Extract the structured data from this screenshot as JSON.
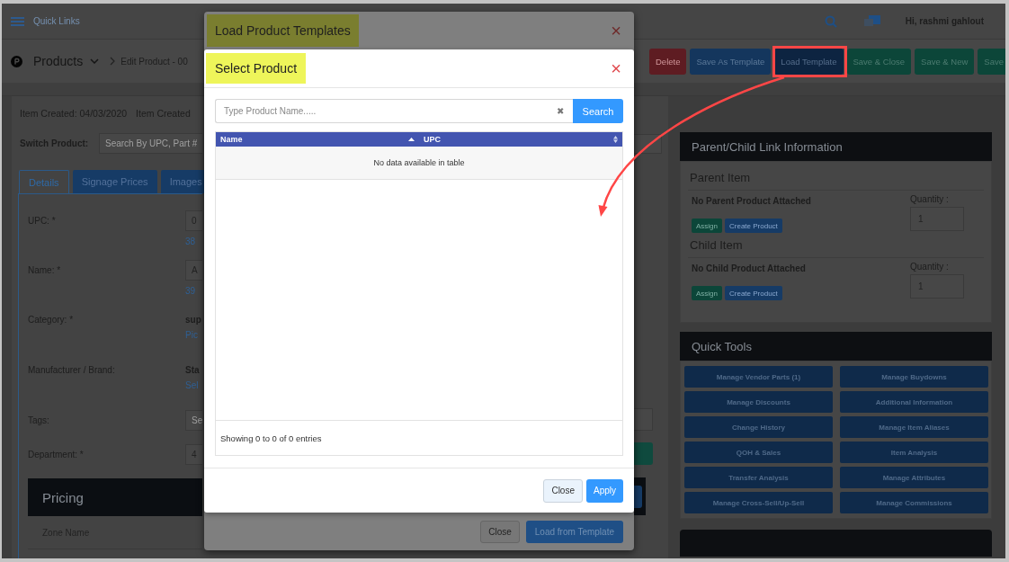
{
  "top_bar": {
    "menu_label": "Quick Links",
    "greeting": "Hi, rashmi gahlout"
  },
  "breadcrumb": {
    "section": "Products",
    "current": "Edit Product - 00"
  },
  "toolbar_buttons": [
    {
      "label": "Delete",
      "kind": "danger"
    },
    {
      "label": "Save As Template",
      "kind": "primary"
    },
    {
      "label": "Load Template",
      "kind": "active"
    },
    {
      "label": "Save & Close",
      "kind": "success"
    },
    {
      "label": "Save & New",
      "kind": "success"
    },
    {
      "label": "Save",
      "kind": "success"
    }
  ],
  "product_info": {
    "created": "Item Created: 04/03/2020",
    "created_by": "Item Created"
  },
  "switch_product": {
    "label": "Switch Product:",
    "placeholder": "Search By UPC, Part #"
  },
  "tabs": [
    {
      "label": "Details",
      "selected": true
    },
    {
      "label": "Signage Prices",
      "selected": false
    },
    {
      "label": "Images",
      "selected": false
    }
  ],
  "form_fields": [
    {
      "kind": "input",
      "label": "UPC: *",
      "value": "0",
      "link": "38"
    },
    {
      "kind": "input",
      "label": "Name: *",
      "value": "A",
      "link": "39"
    },
    {
      "kind": "text",
      "label": "Category: *",
      "value": "sup",
      "link": "Pic"
    },
    {
      "kind": "text",
      "label": "Manufacturer / Brand:",
      "value": "Sta",
      "link": "Sel"
    },
    {
      "kind": "input",
      "label": "Tags:",
      "placeholder": "Se"
    },
    {
      "kind": "input",
      "label": "Department: *",
      "value": "4"
    }
  ],
  "pricing": {
    "title": "Pricing",
    "column": "Zone Name"
  },
  "parent_child": {
    "title": "Parent/Child Link Information",
    "sections": [
      {
        "title": "Parent Item",
        "message": "No Parent Product Attached",
        "quantity_label": "Quantity :",
        "quantity": "1",
        "buttons": [
          {
            "label": "Assign",
            "kind": "success"
          },
          {
            "label": "Create Product",
            "kind": "primary"
          }
        ]
      },
      {
        "title": "Child Item",
        "message": "No Child Product Attached",
        "quantity_label": "Quantity :",
        "quantity": "1",
        "buttons": [
          {
            "label": "Assign",
            "kind": "success"
          },
          {
            "label": "Create Product",
            "kind": "primary"
          }
        ]
      }
    ]
  },
  "quick_tools": {
    "title": "Quick Tools",
    "buttons": [
      "Manage Vendor Parts (1)",
      "Manage Buydowns",
      "Manage Discounts",
      "Additional Information",
      "Change History",
      "Manage Item Aliases",
      "QOH & Sales",
      "Item Analysis",
      "Transfer Analysis",
      "Manage Attributes",
      "Manage Cross-Sell/Up-Sell",
      "Manage Commissions"
    ]
  },
  "outer_modal": {
    "title": "Load Product Templates",
    "close": "×",
    "buttons": [
      {
        "label": "Close",
        "kind": "secondary"
      },
      {
        "label": "Load from Template",
        "kind": "primary"
      }
    ]
  },
  "inner_modal": {
    "title": "Select Product",
    "close": "×",
    "search": {
      "placeholder": "Type Product Name.....",
      "clear": "✖",
      "button": "Search"
    },
    "table": {
      "columns": [
        {
          "label": "Name",
          "sorted": true
        },
        {
          "label": "UPC",
          "sorted": false
        }
      ],
      "empty_message": "No data available in table",
      "info": "Showing 0 to 0 of 0 entries"
    },
    "buttons": [
      {
        "label": "Close",
        "kind": "secondary"
      },
      {
        "label": "Apply",
        "kind": "primary"
      }
    ]
  }
}
